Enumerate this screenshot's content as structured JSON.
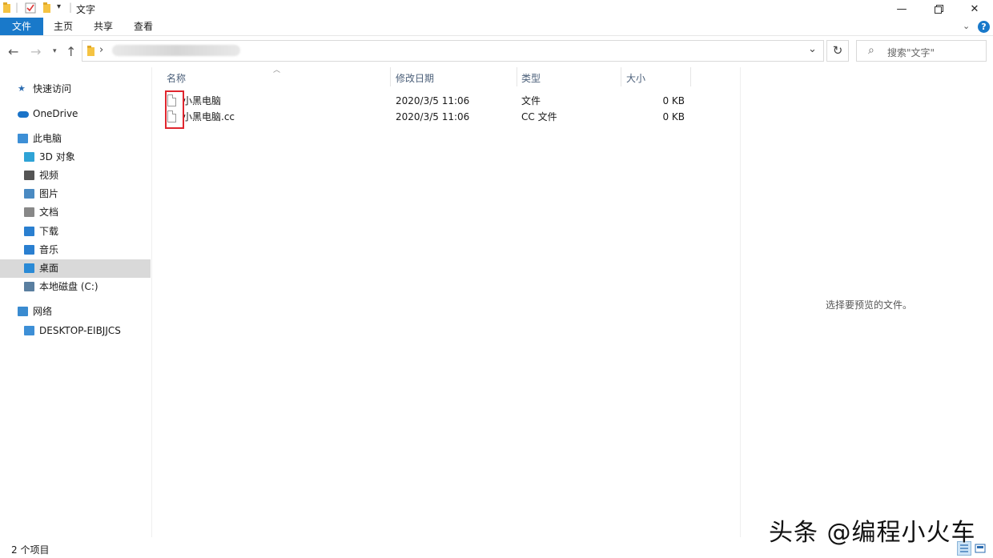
{
  "window": {
    "title": "文字"
  },
  "ribbon": {
    "tabs": [
      "文件",
      "主页",
      "共享",
      "查看"
    ]
  },
  "address": {
    "refresh_glyph": "↻"
  },
  "search": {
    "placeholder": "搜索\"文字\""
  },
  "sidebar": {
    "items": [
      {
        "label": "快速访问",
        "icon": "star-icon"
      },
      {
        "label": "OneDrive",
        "icon": "cloud-icon"
      },
      {
        "label": "此电脑",
        "icon": "computer-icon"
      },
      {
        "label": "3D 对象",
        "icon": "cube-icon"
      },
      {
        "label": "视频",
        "icon": "film-icon"
      },
      {
        "label": "图片",
        "icon": "picture-icon"
      },
      {
        "label": "文档",
        "icon": "document-icon"
      },
      {
        "label": "下载",
        "icon": "download-arrow-icon"
      },
      {
        "label": "音乐",
        "icon": "music-note-icon"
      },
      {
        "label": "桌面",
        "icon": "desktop-icon",
        "selected": true
      },
      {
        "label": "本地磁盘 (C:)",
        "icon": "drive-icon"
      },
      {
        "label": "网络",
        "icon": "network-icon"
      },
      {
        "label": "DESKTOP-EIBJJCS",
        "icon": "computer-icon"
      }
    ]
  },
  "columns": {
    "name": "名称",
    "modified": "修改日期",
    "type": "类型",
    "size": "大小"
  },
  "files": [
    {
      "name": "小黑电脑",
      "modified": "2020/3/5 11:06",
      "type": "文件",
      "size": "0 KB"
    },
    {
      "name": "小黑电脑.cc",
      "modified": "2020/3/5 11:06",
      "type": "CC 文件",
      "size": "0 KB"
    }
  ],
  "preview": {
    "message": "选择要预览的文件。"
  },
  "status": {
    "count": "2 个项目"
  },
  "watermark": {
    "text": "头条 @编程小火车"
  },
  "colors": {
    "accent": "#1979ca",
    "highlight_box": "#e0262e",
    "selected_bg": "#d9d9d9"
  }
}
